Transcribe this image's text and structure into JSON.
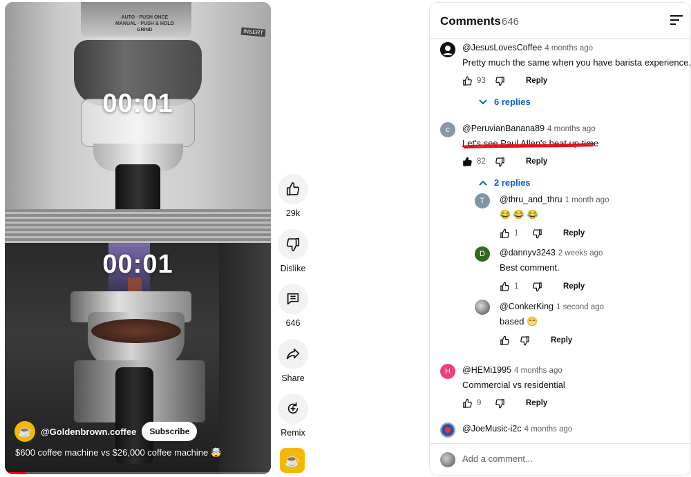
{
  "video": {
    "timer_top": "00:01",
    "timer_bottom": "00:01",
    "machine_label": "AUTO · PUSH ONCE\nMANUAL · PUSH & HOLD\nGRIND",
    "insert_label": "INSERT",
    "channel_name": "@Goldenbrown.coffee",
    "subscribe_label": "Subscribe",
    "title": "$600 coffee machine vs $26,000 coffee machine 🤯",
    "progress_fraction": 0.08,
    "accent_color": "#ff0000",
    "channel_avatar_color": "#f5b800"
  },
  "actions": {
    "like": {
      "icon": "thumb-up-icon",
      "label": "29k"
    },
    "dislike": {
      "icon": "thumb-down-icon",
      "label": "Dislike"
    },
    "comments": {
      "icon": "comment-icon",
      "label": "646"
    },
    "share": {
      "icon": "share-icon",
      "label": "Share"
    },
    "remix": {
      "icon": "remix-icon",
      "label": "Remix"
    }
  },
  "comments_panel": {
    "title": "Comments",
    "count": "646",
    "add_comment_placeholder": "Add a comment...",
    "reply_label": "Reply",
    "comments": [
      {
        "author": "@JesusLovesCoffee",
        "ago": "4 months ago",
        "text": "Pretty much the same when you have barista experience.",
        "likes": "93",
        "replies_toggle": "6 replies"
      },
      {
        "author": "@PeruvianBanana89",
        "avatar_letter": "c",
        "ago": "4 months ago",
        "text": "Let's see Paul Allen's heat up time",
        "likes": "82",
        "replies_toggle": "2 replies"
      },
      {
        "author": "@thru_and_thru",
        "avatar_letter": "T",
        "ago": "1 month ago",
        "text": "😂 😂 😂",
        "likes": "1"
      },
      {
        "author": "@dannyv3243",
        "avatar_letter": "D",
        "ago": "2 weeks ago",
        "text": "Best comment.",
        "likes": "1"
      },
      {
        "author": "@ConkerKing",
        "ago": "1 second ago",
        "text": "based 😁",
        "likes": ""
      },
      {
        "author": "@HEMi1995",
        "avatar_letter": "H",
        "ago": "4 months ago",
        "text": "Commercial vs residential",
        "likes": "9"
      },
      {
        "author": "@JoeMusic-i2c",
        "ago": "4 months ago"
      }
    ]
  }
}
